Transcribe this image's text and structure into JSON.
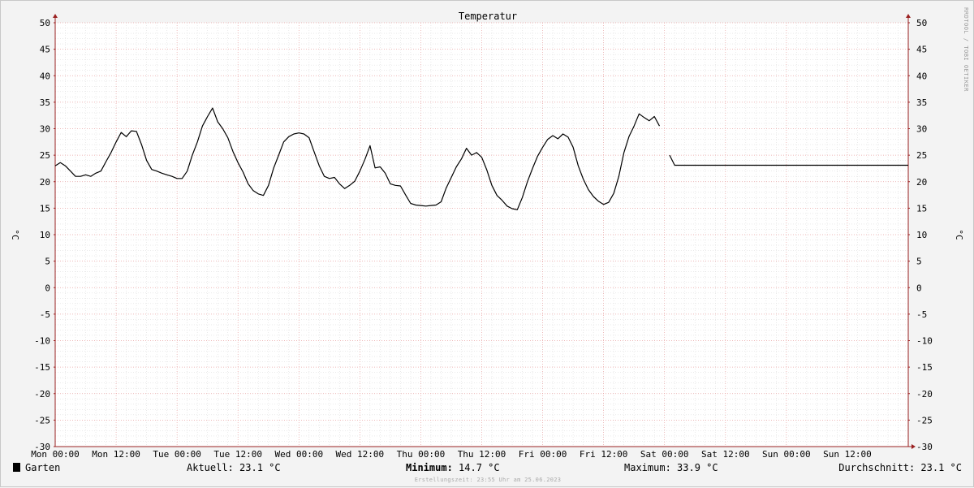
{
  "chart_data": {
    "type": "line",
    "title": "Temperatur",
    "ylabel": "°C",
    "ylim": [
      -30,
      50
    ],
    "yticks": [
      "50",
      "45",
      "40",
      "35",
      "30",
      "25",
      "20",
      "15",
      "10",
      "5",
      "0",
      "-5",
      "-10",
      "-15",
      "-20",
      "-25",
      "-30"
    ],
    "xticks": [
      "Mon 00:00",
      "Mon 12:00",
      "Tue 00:00",
      "Tue 12:00",
      "Wed 00:00",
      "Wed 12:00",
      "Thu 00:00",
      "Thu 12:00",
      "Fri 00:00",
      "Fri 12:00",
      "Sat 00:00",
      "Sat 12:00",
      "Sun 00:00",
      "Sun 12:00"
    ],
    "xlim_hours": [
      0,
      168
    ],
    "grid": true,
    "series": [
      {
        "name": "Garten",
        "color": "#000000",
        "x_hours": [
          0,
          1,
          2,
          3,
          4,
          5,
          6,
          7,
          8,
          9,
          10,
          11,
          12,
          13,
          14,
          15,
          16,
          17,
          18,
          19,
          20,
          21,
          22,
          23,
          24,
          25,
          26,
          27,
          28,
          29,
          30,
          31,
          32,
          33,
          34,
          35,
          36,
          37,
          38,
          39,
          40,
          41,
          42,
          43,
          44,
          45,
          46,
          47,
          48,
          49,
          50,
          51,
          52,
          53,
          54,
          55,
          56,
          57,
          58,
          59,
          60,
          61,
          62,
          63,
          64,
          65,
          66,
          67,
          68,
          69,
          70,
          71,
          72,
          73,
          74,
          75,
          76,
          77,
          78,
          79,
          80,
          81,
          82,
          83,
          84,
          85,
          86,
          87,
          88,
          89,
          90,
          91,
          92,
          93,
          94,
          95,
          96,
          97,
          98,
          99,
          100,
          101,
          102,
          103,
          104,
          105,
          106,
          107,
          108,
          109,
          110,
          111,
          112,
          113,
          114,
          115,
          116,
          117,
          118,
          119,
          120,
          121,
          122,
          123,
          124,
          125,
          126,
          127,
          128,
          129,
          130,
          131,
          132,
          133,
          134,
          135,
          136,
          137,
          138,
          139,
          140,
          141,
          142,
          143,
          144,
          145,
          146,
          147,
          148,
          149,
          150,
          151,
          152,
          153,
          154,
          155,
          156,
          157,
          158,
          159,
          160,
          161,
          162,
          163,
          164,
          165,
          166,
          167,
          168
        ],
        "y": [
          23.0,
          23.6,
          23.0,
          22.0,
          21.0,
          21.0,
          21.3,
          21.0,
          21.6,
          22.0,
          23.8,
          25.5,
          27.5,
          29.3,
          28.5,
          29.6,
          29.5,
          27.0,
          24.0,
          22.3,
          22.0,
          21.6,
          21.3,
          21.0,
          20.6,
          20.6,
          22.0,
          25.0,
          27.5,
          30.5,
          32.3,
          33.9,
          31.3,
          30.0,
          28.3,
          25.7,
          23.6,
          21.8,
          19.6,
          18.3,
          17.7,
          17.4,
          19.3,
          22.5,
          25.0,
          27.5,
          28.5,
          29.0,
          29.2,
          29.0,
          28.3,
          25.6,
          23.0,
          21.0,
          20.6,
          20.8,
          19.6,
          18.7,
          19.3,
          20.1,
          22.0,
          24.2,
          26.8,
          22.6,
          22.8,
          21.6,
          19.6,
          19.3,
          19.2,
          17.5,
          15.9,
          15.6,
          15.5,
          15.4,
          15.5,
          15.6,
          16.2,
          18.8,
          20.8,
          22.8,
          24.3,
          26.3,
          25.0,
          25.5,
          24.6,
          22.2,
          19.3,
          17.4,
          16.5,
          15.4,
          14.9,
          14.7,
          17.0,
          20.0,
          22.5,
          24.8,
          26.5,
          28.0,
          28.7,
          28.1,
          29.0,
          28.4,
          26.5,
          23.0,
          20.5,
          18.5,
          17.2,
          16.3,
          15.7,
          16.1,
          17.8,
          21.0,
          25.5,
          28.5,
          30.5,
          32.8,
          32.1,
          31.5,
          32.3,
          30.5,
          28.0,
          25.0,
          23.1,
          23.1,
          23.1,
          23.1,
          23.1,
          23.1,
          23.1,
          23.1,
          23.1,
          23.1,
          23.1,
          23.1,
          23.1,
          23.1,
          23.1,
          23.1,
          23.1,
          23.1,
          23.1,
          23.1,
          23.1,
          23.1,
          23.1,
          23.1,
          23.1,
          23.1,
          23.1,
          23.1,
          23.1,
          23.1,
          23.1,
          23.1,
          23.1,
          23.1,
          23.1,
          23.1,
          23.1,
          23.1,
          23.1,
          23.1,
          23.1,
          23.1,
          23.1,
          23.1,
          23.1,
          23.1,
          23.1,
          23.1
        ]
      }
    ],
    "gaps_hours": [
      [
        119.5,
        120.5
      ]
    ]
  },
  "credit": "RRDTOOL / TOBI OETIKER",
  "legend": {
    "series_label": "Garten",
    "series_color": "#000000",
    "aktuell": "Aktuell: 23.1 °C",
    "minimum_label": "Minimum:",
    "minimum_value": " 14.7 °C",
    "maximum": "Maximum: 33.9 °C",
    "durchschnitt": "Durchschnitt: 23.1 °C"
  },
  "footnote": "Erstellungszeit: 23:55 Uhr am 25.06.2023",
  "colors": {
    "background": "#f3f3f3",
    "canvas": "#ffffff",
    "grid_minor": "#dddddd",
    "grid_major": "#e8a0a0",
    "axis": "#9a2020"
  }
}
